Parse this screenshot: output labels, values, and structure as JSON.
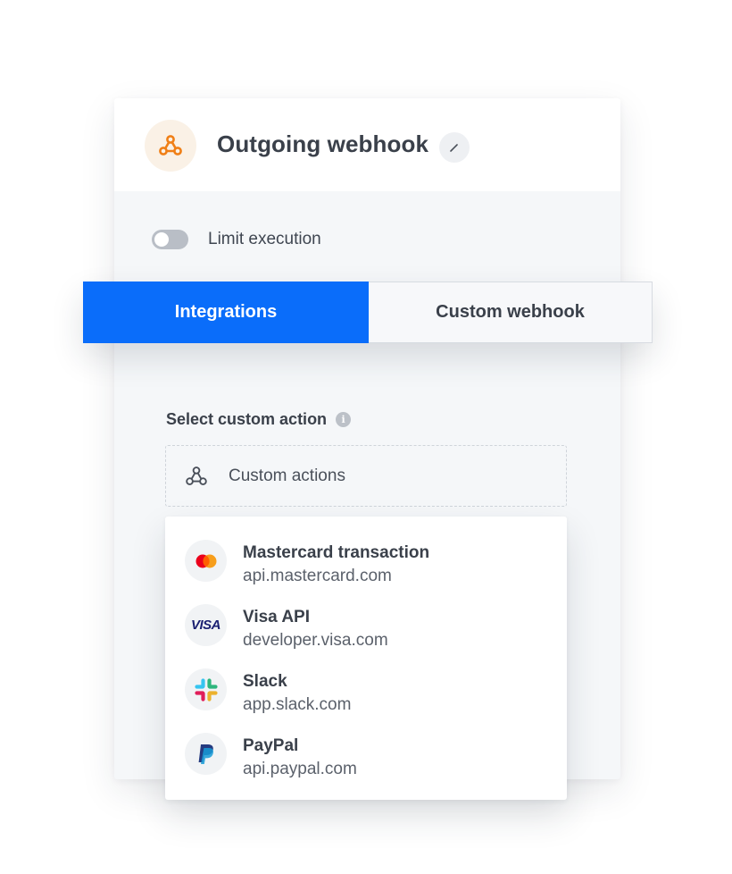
{
  "header": {
    "title": "Outgoing webhook",
    "icon": "webhook-icon",
    "icon_color": "#f07f16",
    "edit_icon": "pencil-icon"
  },
  "limit_execution": {
    "label": "Limit execution",
    "enabled": false
  },
  "tabs": [
    {
      "label": "Integrations",
      "active": true
    },
    {
      "label": "Custom webhook",
      "active": false
    }
  ],
  "custom_action": {
    "label": "Select custom action",
    "info_icon": "info-icon",
    "placeholder": "Custom actions"
  },
  "dropdown": {
    "items": [
      {
        "name": "Mastercard transaction",
        "url": "api.mastercard.com",
        "icon": "mastercard-logo"
      },
      {
        "name": "Visa API",
        "url": "developer.visa.com",
        "icon": "visa-logo",
        "logo_text": "VISA"
      },
      {
        "name": "Slack",
        "url": "app.slack.com",
        "icon": "slack-logo"
      },
      {
        "name": "PayPal",
        "url": "api.paypal.com",
        "icon": "paypal-logo"
      }
    ]
  },
  "colors": {
    "accent": "#0a6dfa",
    "card_background": "#f5f7f9",
    "text": "#3a404a"
  }
}
